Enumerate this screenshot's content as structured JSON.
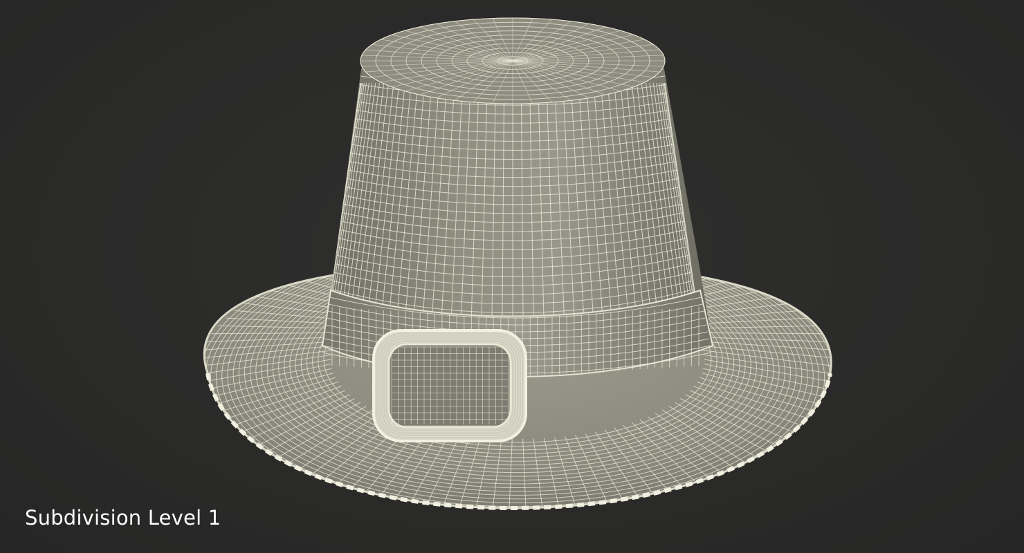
{
  "caption": "Subdivision Level 1",
  "subject": "wireframe-hat-render",
  "colors": {
    "background": "#2b2b2a",
    "surface": "#8e8d7f",
    "wire": "#ecebd9",
    "caption_text": "#ffffff"
  }
}
